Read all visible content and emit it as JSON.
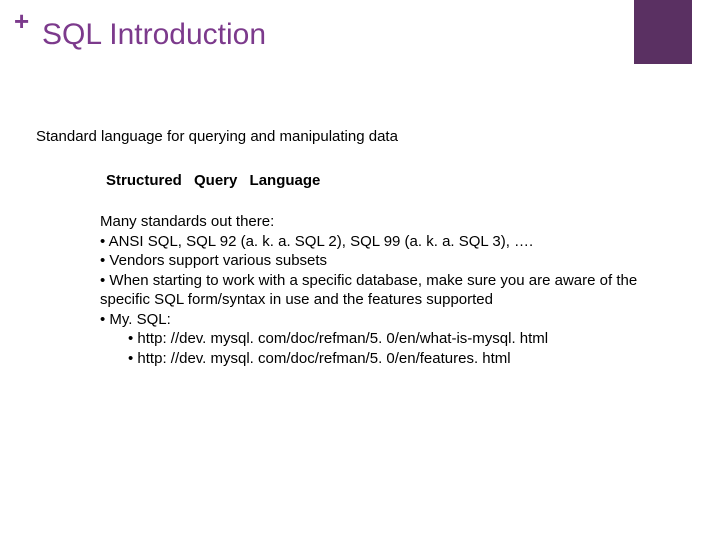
{
  "plus": "+",
  "title": "SQL Introduction",
  "subtitle": "Standard language for querying and manipulating data",
  "heading2": "Structured Query Language",
  "body": {
    "line1": "Many standards out there:",
    "line2": " •  ANSI SQL,  SQL 92 (a. k. a. SQL 2),  SQL 99 (a. k. a. SQL 3),  ….",
    "line3": " •  Vendors support various subsets",
    "line4": " •   When starting to work with a specific database, make sure you are aware of the specific SQL form/syntax in use and the features supported",
    "line5": " •  My. SQL:",
    "line6": " •  http: //dev. mysql. com/doc/refman/5. 0/en/what-is-mysql. html",
    "line7": " •  http: //dev. mysql. com/doc/refman/5. 0/en/features. html"
  }
}
